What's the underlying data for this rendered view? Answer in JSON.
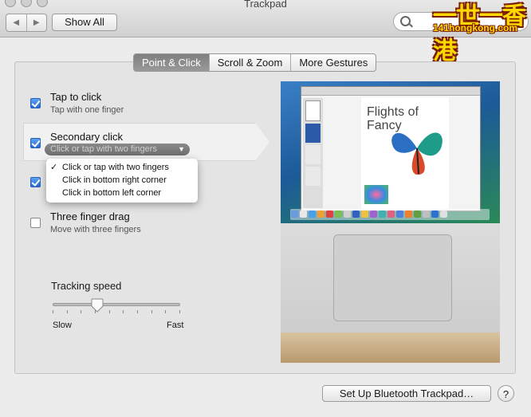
{
  "window": {
    "title": "Trackpad"
  },
  "toolbar": {
    "show_all_label": "Show All",
    "back_icon": "◀",
    "forward_icon": "▶"
  },
  "watermark": {
    "chinese": "一世一香港",
    "url": "141hongkong.com"
  },
  "tabs": [
    {
      "label": "Point & Click",
      "active": true
    },
    {
      "label": "Scroll & Zoom",
      "active": false
    },
    {
      "label": "More Gestures",
      "active": false
    }
  ],
  "options": [
    {
      "title": "Tap to click",
      "subtitle": "Tap with one finger",
      "checked": true
    },
    {
      "title": "Secondary click",
      "selected_value": "Click or tap with two fingers",
      "checked": true
    },
    {
      "title": "Three finger drag",
      "subtitle": "Move with three fingers",
      "checked": false
    }
  ],
  "secondary_menu": {
    "items": [
      "Click or tap with two fingers",
      "Click in bottom right corner",
      "Click in bottom left corner"
    ],
    "selected_index": 0
  },
  "tracking": {
    "title": "Tracking speed",
    "slow": "Slow",
    "fast": "Fast",
    "value": 0.35
  },
  "preview": {
    "doc_title_line1": "Flights of",
    "doc_title_line2": "Fancy"
  },
  "footer": {
    "bluetooth_label": "Set Up Bluetooth Trackpad…",
    "help_label": "?"
  },
  "colors": {
    "accent": "#2969d3",
    "tab_active": "#8a8a8a"
  }
}
